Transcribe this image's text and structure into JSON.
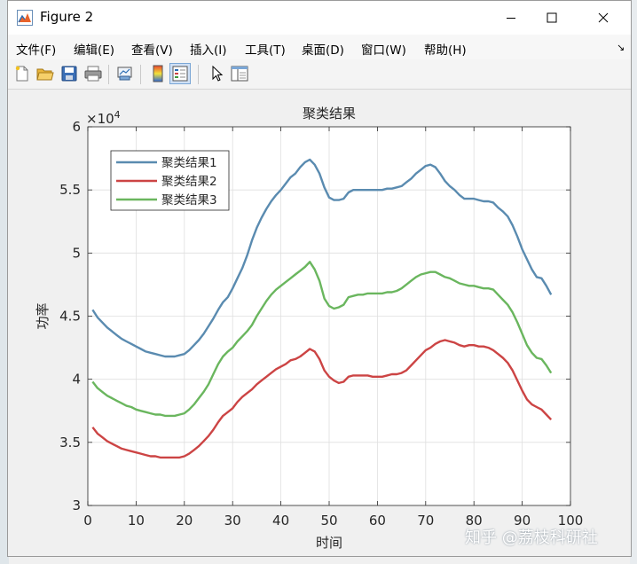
{
  "window": {
    "title": "Figure 2"
  },
  "menu": [
    {
      "label": "文件(F)"
    },
    {
      "label": "编辑(E)"
    },
    {
      "label": "查看(V)"
    },
    {
      "label": "插入(I)"
    },
    {
      "label": "工具(T)"
    },
    {
      "label": "桌面(D)"
    },
    {
      "label": "窗口(W)"
    },
    {
      "label": "帮助(H)"
    }
  ],
  "toolbar_icons": [
    "new-figure-icon",
    "open-file-icon",
    "save-icon",
    "print-icon",
    "link-plot-icon",
    "insert-colorbar-icon",
    "insert-legend-icon",
    "edit-plot-arrow-icon",
    "property-inspector-icon"
  ],
  "watermark": "知乎 @荔枝科研社",
  "chart_data": {
    "type": "line",
    "title": "聚类结果",
    "xlabel": "时间",
    "ylabel": "功率",
    "exponent_label": "×10^4",
    "exponent_base": "×10",
    "exponent_power": "4",
    "xlim": [
      0,
      100
    ],
    "ylim": [
      3,
      6
    ],
    "xticks": [
      0,
      10,
      20,
      30,
      40,
      50,
      60,
      70,
      80,
      90,
      100
    ],
    "yticks": [
      3,
      3.5,
      4,
      4.5,
      5,
      5.5,
      6
    ],
    "ytick_labels": [
      "3",
      "3.5",
      "4",
      "4.5",
      "5",
      "5.5",
      "6"
    ],
    "grid": true,
    "legend_position": "top-left",
    "x": [
      1,
      2,
      3,
      4,
      5,
      6,
      7,
      8,
      9,
      10,
      11,
      12,
      13,
      14,
      15,
      16,
      17,
      18,
      19,
      20,
      21,
      22,
      23,
      24,
      25,
      26,
      27,
      28,
      29,
      30,
      31,
      32,
      33,
      34,
      35,
      36,
      37,
      38,
      39,
      40,
      41,
      42,
      43,
      44,
      45,
      46,
      47,
      48,
      49,
      50,
      51,
      52,
      53,
      54,
      55,
      56,
      57,
      58,
      59,
      60,
      61,
      62,
      63,
      64,
      65,
      66,
      67,
      68,
      69,
      70,
      71,
      72,
      73,
      74,
      75,
      76,
      77,
      78,
      79,
      80,
      81,
      82,
      83,
      84,
      85,
      86,
      87,
      88,
      89,
      90,
      91,
      92,
      93,
      94,
      95,
      96
    ],
    "series": [
      {
        "name": "聚类结果1",
        "color": "#5a8bb0",
        "values": [
          4.55,
          4.49,
          4.45,
          4.41,
          4.38,
          4.35,
          4.32,
          4.3,
          4.28,
          4.26,
          4.24,
          4.22,
          4.21,
          4.2,
          4.19,
          4.18,
          4.18,
          4.18,
          4.19,
          4.2,
          4.23,
          4.27,
          4.31,
          4.36,
          4.42,
          4.48,
          4.55,
          4.61,
          4.65,
          4.72,
          4.8,
          4.88,
          4.98,
          5.1,
          5.2,
          5.28,
          5.35,
          5.41,
          5.46,
          5.5,
          5.55,
          5.6,
          5.63,
          5.68,
          5.72,
          5.74,
          5.7,
          5.63,
          5.52,
          5.44,
          5.42,
          5.42,
          5.43,
          5.48,
          5.5,
          5.5,
          5.5,
          5.5,
          5.5,
          5.5,
          5.5,
          5.51,
          5.51,
          5.52,
          5.53,
          5.56,
          5.59,
          5.63,
          5.66,
          5.69,
          5.7,
          5.68,
          5.63,
          5.57,
          5.53,
          5.5,
          5.46,
          5.43,
          5.43,
          5.43,
          5.42,
          5.41,
          5.41,
          5.4,
          5.36,
          5.33,
          5.29,
          5.22,
          5.13,
          5.03,
          4.95,
          4.87,
          4.81,
          4.8,
          4.74,
          4.67
        ]
      },
      {
        "name": "聚类结果2",
        "color": "#cc4444",
        "values": [
          3.62,
          3.57,
          3.54,
          3.51,
          3.49,
          3.47,
          3.45,
          3.44,
          3.43,
          3.42,
          3.41,
          3.4,
          3.39,
          3.39,
          3.38,
          3.38,
          3.38,
          3.38,
          3.38,
          3.39,
          3.41,
          3.44,
          3.47,
          3.51,
          3.55,
          3.6,
          3.66,
          3.71,
          3.74,
          3.77,
          3.82,
          3.86,
          3.89,
          3.92,
          3.96,
          3.99,
          4.02,
          4.05,
          4.08,
          4.1,
          4.12,
          4.15,
          4.16,
          4.18,
          4.21,
          4.24,
          4.22,
          4.16,
          4.07,
          4.02,
          3.99,
          3.97,
          3.98,
          4.02,
          4.03,
          4.03,
          4.03,
          4.03,
          4.02,
          4.02,
          4.02,
          4.03,
          4.04,
          4.04,
          4.05,
          4.07,
          4.11,
          4.15,
          4.19,
          4.23,
          4.25,
          4.28,
          4.3,
          4.31,
          4.3,
          4.29,
          4.27,
          4.26,
          4.27,
          4.27,
          4.26,
          4.26,
          4.25,
          4.23,
          4.2,
          4.17,
          4.13,
          4.07,
          3.99,
          3.91,
          3.84,
          3.8,
          3.78,
          3.76,
          3.72,
          3.68
        ]
      },
      {
        "name": "聚类结果3",
        "color": "#6ab65e",
        "values": [
          3.98,
          3.93,
          3.9,
          3.87,
          3.85,
          3.83,
          3.81,
          3.79,
          3.78,
          3.76,
          3.75,
          3.74,
          3.73,
          3.72,
          3.72,
          3.71,
          3.71,
          3.71,
          3.72,
          3.73,
          3.76,
          3.8,
          3.85,
          3.9,
          3.96,
          4.04,
          4.12,
          4.18,
          4.22,
          4.25,
          4.3,
          4.34,
          4.38,
          4.43,
          4.5,
          4.56,
          4.62,
          4.67,
          4.71,
          4.74,
          4.77,
          4.8,
          4.83,
          4.86,
          4.89,
          4.93,
          4.87,
          4.78,
          4.64,
          4.58,
          4.56,
          4.57,
          4.59,
          4.65,
          4.66,
          4.67,
          4.67,
          4.68,
          4.68,
          4.68,
          4.68,
          4.69,
          4.69,
          4.7,
          4.72,
          4.75,
          4.78,
          4.81,
          4.83,
          4.84,
          4.85,
          4.85,
          4.83,
          4.81,
          4.8,
          4.78,
          4.76,
          4.75,
          4.74,
          4.74,
          4.73,
          4.72,
          4.72,
          4.71,
          4.67,
          4.63,
          4.59,
          4.53,
          4.45,
          4.36,
          4.27,
          4.21,
          4.17,
          4.16,
          4.11,
          4.05
        ]
      }
    ]
  }
}
